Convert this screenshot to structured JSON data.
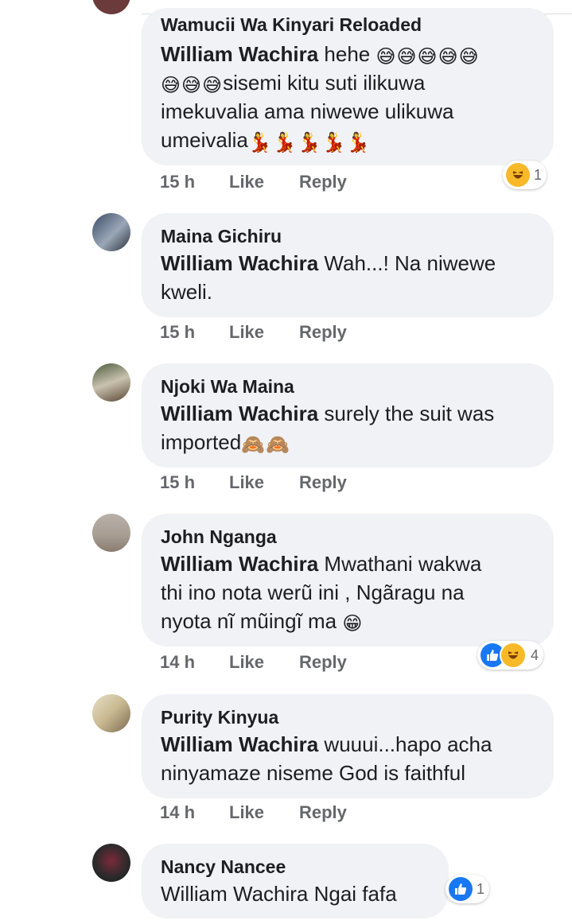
{
  "comments": [
    {
      "author": "Wamucii Wa Kinyari Reloaded",
      "mention": "William Wachira",
      "lines": [
        " hehe ",
        "sisemi kitu suti ilikuwa",
        "imekuvalia ama niwewe ulikuwa",
        "umeivalia"
      ],
      "emoji": {
        "grin_sweat": "😅",
        "dancer": "💃"
      },
      "time": "15 h",
      "like": "Like",
      "reply": "Reply",
      "reaction_count": "1"
    },
    {
      "author": "Maina Gichiru",
      "mention": "William Wachira",
      "lines": [
        " Wah...! Na niwewe",
        "kweli."
      ],
      "time": "15 h",
      "like": "Like",
      "reply": "Reply"
    },
    {
      "author": "Njoki Wa Maina",
      "mention": "William Wachira",
      "lines": [
        " surely the suit was",
        "imported"
      ],
      "emoji": {
        "see_no_evil": "🙈"
      },
      "time": "15 h",
      "like": "Like",
      "reply": "Reply"
    },
    {
      "author": "John Nganga",
      "mention": "William Wachira",
      "lines": [
        " Mwathani wakwa",
        "thi ino nota werũ ini , Ngãragu na",
        "nyota nĩ mũingĩ ma "
      ],
      "emoji": {
        "grin": "😁"
      },
      "time": "14 h",
      "like": "Like",
      "reply": "Reply",
      "reaction_count": "4"
    },
    {
      "author": "Purity Kinyua",
      "mention": "William Wachira",
      "lines": [
        " wuuui...hapo acha",
        "ninyamaze niseme God is faithful"
      ],
      "time": "14 h",
      "like": "Like",
      "reply": "Reply"
    },
    {
      "author": "Nancy Nancee",
      "mention": "William Wachira",
      "lines": [
        " Ngai fafa"
      ],
      "reaction_count": "1"
    }
  ]
}
